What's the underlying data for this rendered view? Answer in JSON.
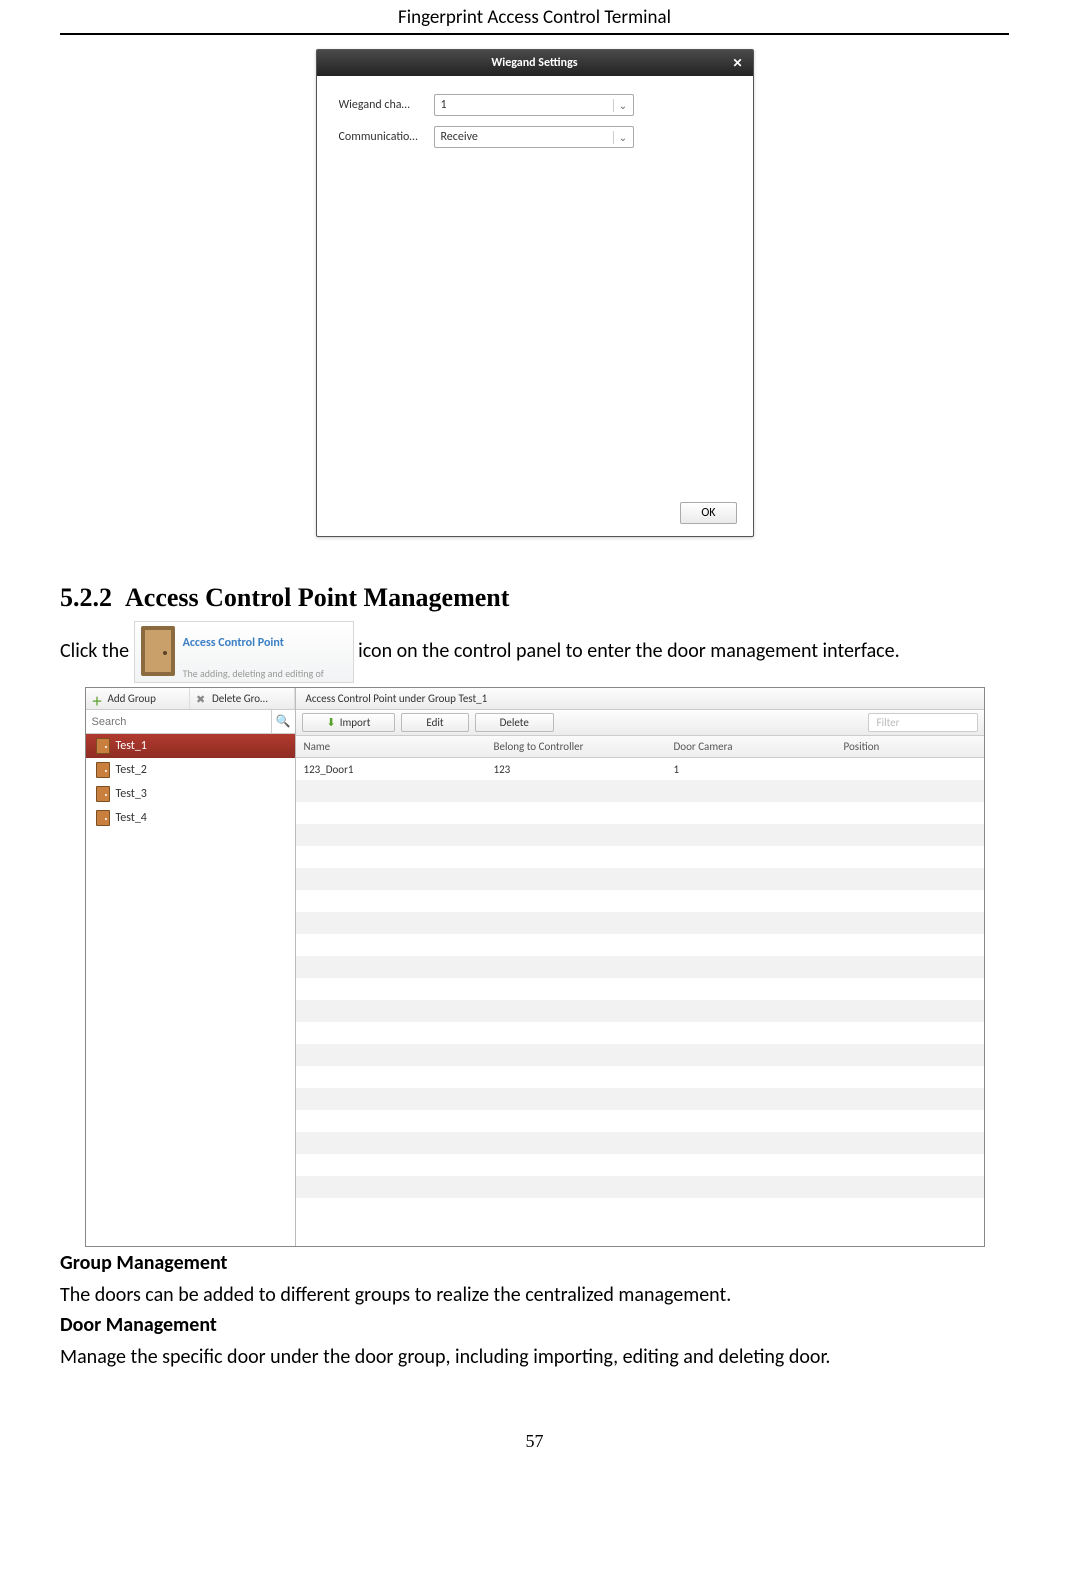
{
  "header": "Fingerprint Access Control Terminal",
  "dialog": {
    "title": "Wiegand Settings",
    "field1_label": "Wiegand cha…",
    "field1_value": "1",
    "field2_label": "Communicatio…",
    "field2_value": "Receive",
    "ok": "OK"
  },
  "section_num": "5.2.2",
  "section_title": "Access Control Point Management",
  "click_pre": "Click the",
  "click_post": " icon on the control panel to enter the door management interface.",
  "card": {
    "title": "Access Control Point",
    "desc": "The adding, deleting and editing of person and department."
  },
  "panel": {
    "add_group": "Add Group",
    "del_group": "Delete Gro…",
    "search_ph": "Search",
    "tree": [
      "Test_1",
      "Test_2",
      "Test_3",
      "Test_4"
    ],
    "rtitle": "Access Control Point under Group Test_1",
    "import": "Import",
    "edit": "Edit",
    "delete": "Delete",
    "filter": "Filter",
    "cols": [
      "Name",
      "Belong to Controller",
      "Door Camera",
      "Position"
    ],
    "row": [
      "123_Door1",
      "123",
      "1",
      ""
    ]
  },
  "gm_h": "Group Management",
  "gm_t": "The doors can be added to different groups to realize the centralized management.",
  "dm_h": "Door Management",
  "dm_t": "Manage the specific door under the door group, including importing, editing and deleting door.",
  "page_num": "57"
}
